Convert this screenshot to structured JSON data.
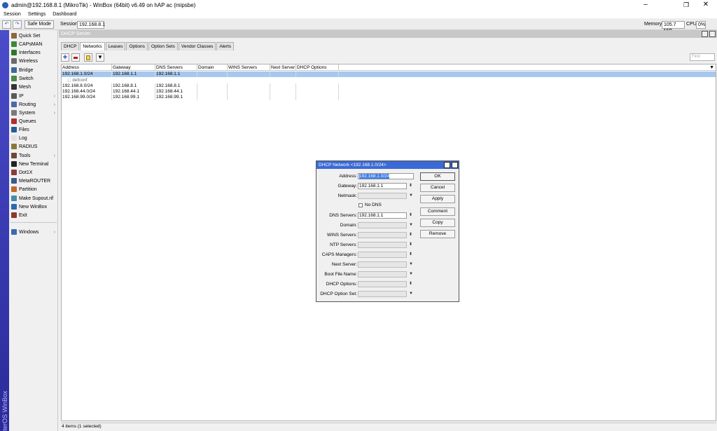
{
  "window": {
    "title": "admin@192.168.8.1 (MikroTik) - WinBox (64bit) v6.49 on hAP ac (mipsbe)"
  },
  "menu": [
    "Session",
    "Settings",
    "Dashboard"
  ],
  "toolbar": {
    "undo_icon": "undo-icon",
    "redo_icon": "redo-icon",
    "safe_mode": "Safe Mode",
    "session_label": "Session:",
    "session_value": "192.168.8.1",
    "memory_label": "Memory:",
    "memory_value": "105.7 MiB",
    "cpu_label": "CPU:",
    "cpu_value": "0%"
  },
  "sidebar": {
    "vertical_text": "RouterOS WinBox",
    "items": [
      {
        "label": "Quick Set",
        "icon": "wand-icon",
        "color": "#8a6a3a",
        "arrow": ""
      },
      {
        "label": "CAPsMAN",
        "icon": "capsman-icon",
        "color": "#3a8a3a",
        "arrow": ""
      },
      {
        "label": "Interfaces",
        "icon": "interfaces-icon",
        "color": "#2a7a2a",
        "arrow": ""
      },
      {
        "label": "Wireless",
        "icon": "wireless-icon",
        "color": "#6a6a6a",
        "arrow": ""
      },
      {
        "label": "Bridge",
        "icon": "bridge-icon",
        "color": "#3a6a9a",
        "arrow": ""
      },
      {
        "label": "Switch",
        "icon": "switch-icon",
        "color": "#4a8a4a",
        "arrow": ""
      },
      {
        "label": "Mesh",
        "icon": "mesh-icon",
        "color": "#333333",
        "arrow": ""
      },
      {
        "label": "IP",
        "icon": "ip-icon",
        "color": "#5a5a5a",
        "arrow": "›"
      },
      {
        "label": "Routing",
        "icon": "routing-icon",
        "color": "#4a6aaa",
        "arrow": "›"
      },
      {
        "label": "System",
        "icon": "system-icon",
        "color": "#7a7a7a",
        "arrow": "›"
      },
      {
        "label": "Queues",
        "icon": "queues-icon",
        "color": "#b03030",
        "arrow": ""
      },
      {
        "label": "Files",
        "icon": "files-icon",
        "color": "#2a5a9a",
        "arrow": ""
      },
      {
        "label": "Log",
        "icon": "log-icon",
        "color": "#e0e0e0",
        "arrow": ""
      },
      {
        "label": "RADIUS",
        "icon": "radius-icon",
        "color": "#8a7a3a",
        "arrow": ""
      },
      {
        "label": "Tools",
        "icon": "tools-icon",
        "color": "#6a4a3a",
        "arrow": "›"
      },
      {
        "label": "New Terminal",
        "icon": "terminal-icon",
        "color": "#222222",
        "arrow": ""
      },
      {
        "label": "Dot1X",
        "icon": "dot1x-icon",
        "color": "#8a3a3a",
        "arrow": ""
      },
      {
        "label": "MetaROUTER",
        "icon": "metarouter-icon",
        "color": "#3a5a8a",
        "arrow": ""
      },
      {
        "label": "Partition",
        "icon": "partition-icon",
        "color": "#c06a2a",
        "arrow": ""
      },
      {
        "label": "Make Supout.rif",
        "icon": "supout-icon",
        "color": "#4a8aaa",
        "arrow": ""
      },
      {
        "label": "New WinBox",
        "icon": "winbox-icon",
        "color": "#2a6ab0",
        "arrow": ""
      },
      {
        "label": "Exit",
        "icon": "exit-icon",
        "color": "#8a3a2a",
        "arrow": ""
      },
      {
        "label": "Windows",
        "icon": "windows-icon",
        "color": "#3a6ab0",
        "arrow": "›"
      }
    ]
  },
  "panel": {
    "title": "DHCP Server",
    "tabs": [
      "DHCP",
      "Networks",
      "Leases",
      "Options",
      "Option Sets",
      "Vendor Classes",
      "Alerts"
    ],
    "active_tab": "Networks",
    "find_placeholder": "Find",
    "columns": [
      "Address",
      "Gateway",
      "DNS Servers",
      "Domain",
      "WINS Servers",
      "Next Server",
      "DHCP Options"
    ],
    "rows": [
      {
        "address": "192.168.1.0/24",
        "gateway": "192.168.1.1",
        "dns": "192.168.1.1",
        "selected": true
      },
      {
        "comment": ";;; defconf"
      },
      {
        "address": "192.168.8.0/24",
        "gateway": "192.168.8.1",
        "dns": "192.168.8.1"
      },
      {
        "address": "192.168.44.0/24",
        "gateway": "192.168.44.1",
        "dns": "192.168.44.1"
      },
      {
        "address": "192.168.99.0/24",
        "gateway": "192.168.99.1",
        "dns": "192.168.99.1"
      }
    ],
    "status": "4 items (1 selected)"
  },
  "dialog": {
    "title": "DHCP Network <192.168.1.0/24>",
    "fields": {
      "address": {
        "label": "Address:",
        "value": "192.168.1.0/24"
      },
      "gateway": {
        "label": "Gateway:",
        "value": "192.168.1.1"
      },
      "netmask": {
        "label": "Netmask:",
        "value": ""
      },
      "no_dns": {
        "label": "No DNS"
      },
      "dns_servers": {
        "label": "DNS Servers:",
        "value": "192.168.1.1"
      },
      "domain": {
        "label": "Domain:",
        "value": ""
      },
      "wins_servers": {
        "label": "WINS Servers:",
        "value": ""
      },
      "ntp_servers": {
        "label": "NTP Servers:",
        "value": ""
      },
      "caps_managers": {
        "label": "CAPS Managers:",
        "value": ""
      },
      "next_server": {
        "label": "Next Server:",
        "value": ""
      },
      "boot_file_name": {
        "label": "Boot File Name:",
        "value": ""
      },
      "dhcp_options": {
        "label": "DHCP Options:",
        "value": ""
      },
      "dhcp_option_set": {
        "label": "DHCP Option Set:",
        "value": ""
      }
    },
    "buttons": [
      "OK",
      "Cancel",
      "Apply",
      "Comment",
      "Copy",
      "Remove"
    ]
  }
}
